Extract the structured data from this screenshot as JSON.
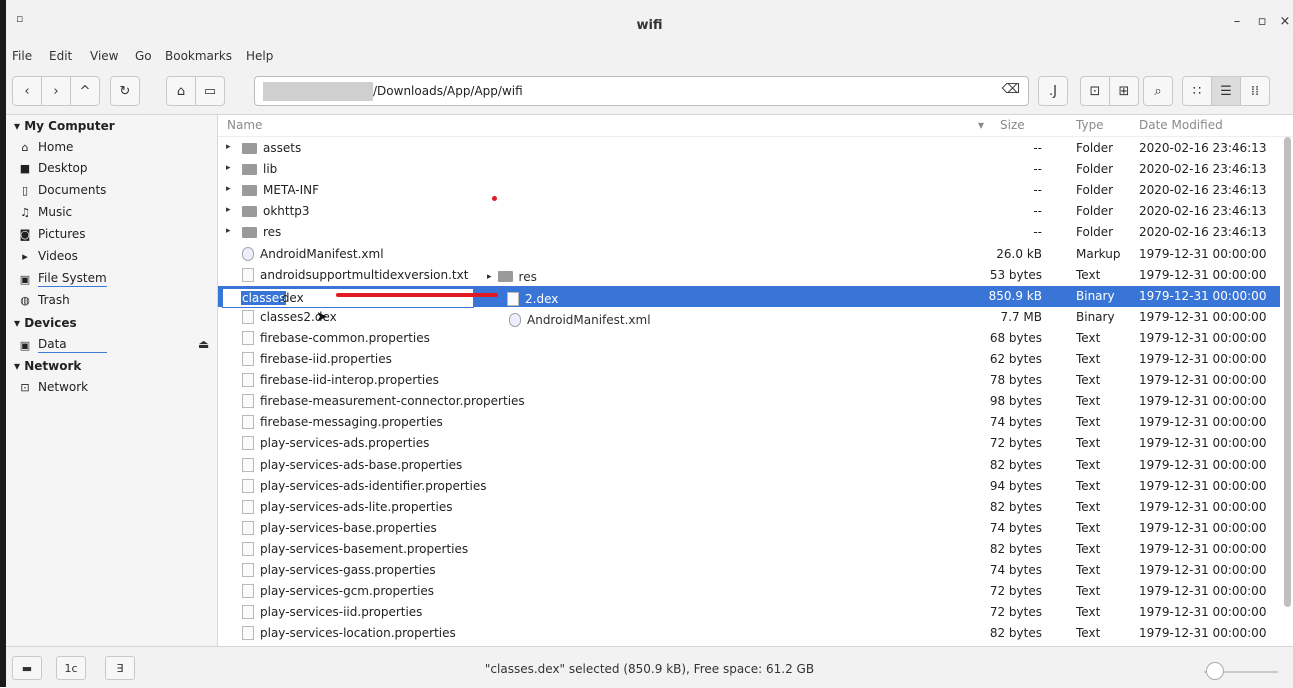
{
  "window": {
    "title": "wifi",
    "menu_icon": "▫",
    "minimize": "–",
    "maximize": "▫",
    "close": "×"
  },
  "menu": [
    "File",
    "Edit",
    "View",
    "Go",
    "Bookmarks",
    "Help"
  ],
  "toolbar": {
    "back": "‹",
    "forward": "›",
    "up": "^",
    "reload": "↻",
    "home": "⌂",
    "computer": "▭",
    "path": "/Downloads/App/App/wifi",
    "clear": "⌫",
    "terminal": "⊡",
    "new_tab": "⊞",
    "search": "⌕",
    "icon_view": "∷",
    "list_view": "☰",
    "compact_view": "⁞⁞"
  },
  "sidebar": {
    "sections": [
      {
        "title": "My Computer",
        "items": [
          {
            "label": "Home",
            "icon": "home-icon"
          },
          {
            "label": "Desktop",
            "icon": "desktop-folder-icon"
          },
          {
            "label": "Documents",
            "icon": "document-icon"
          },
          {
            "label": "Music",
            "icon": "music-icon"
          },
          {
            "label": "Pictures",
            "icon": "camera-icon"
          },
          {
            "label": "Videos",
            "icon": "video-icon"
          },
          {
            "label": "File System",
            "icon": "drive-icon"
          },
          {
            "label": "Trash",
            "icon": "trash-icon"
          }
        ]
      },
      {
        "title": "Devices",
        "items": [
          {
            "label": "Data",
            "icon": "drive-icon",
            "eject": "⏏"
          }
        ]
      },
      {
        "title": "Network",
        "items": [
          {
            "label": "Network",
            "icon": "network-icon"
          }
        ]
      }
    ]
  },
  "columns": {
    "name": "Name",
    "size": "Size",
    "type": "Type",
    "date": "Date Modified"
  },
  "files": [
    {
      "name": "assets",
      "size": "--",
      "type": "Folder",
      "date": "2020-02-16 23:46:13",
      "kind": "folder"
    },
    {
      "name": "lib",
      "size": "--",
      "type": "Folder",
      "date": "2020-02-16 23:46:13",
      "kind": "folder"
    },
    {
      "name": "META-INF",
      "size": "--",
      "type": "Folder",
      "date": "2020-02-16 23:46:13",
      "kind": "folder"
    },
    {
      "name": "okhttp3",
      "size": "--",
      "type": "Folder",
      "date": "2020-02-16 23:46:13",
      "kind": "folder"
    },
    {
      "name": "res",
      "size": "--",
      "type": "Folder",
      "date": "2020-02-16 23:46:13",
      "kind": "folder"
    },
    {
      "name": "AndroidManifest.xml",
      "size": "26.0 kB",
      "type": "Markup",
      "date": "1979-12-31 00:00:00",
      "kind": "xml"
    },
    {
      "name": "androidsupportmultidexversion.txt",
      "size": "53 bytes",
      "type": "Text",
      "date": "1979-12-31 00:00:00",
      "kind": "file"
    },
    {
      "name": "classes.dex",
      "size": "850.9 kB",
      "type": "Binary",
      "date": "1979-12-31 00:00:00",
      "kind": "file",
      "selected": true
    },
    {
      "name": "classes2.dex",
      "size": "7.7 MB",
      "type": "Binary",
      "date": "1979-12-31 00:00:00",
      "kind": "file"
    },
    {
      "name": "firebase-common.properties",
      "size": "68 bytes",
      "type": "Text",
      "date": "1979-12-31 00:00:00",
      "kind": "file"
    },
    {
      "name": "firebase-iid.properties",
      "size": "62 bytes",
      "type": "Text",
      "date": "1979-12-31 00:00:00",
      "kind": "file"
    },
    {
      "name": "firebase-iid-interop.properties",
      "size": "78 bytes",
      "type": "Text",
      "date": "1979-12-31 00:00:00",
      "kind": "file"
    },
    {
      "name": "firebase-measurement-connector.properties",
      "size": "98 bytes",
      "type": "Text",
      "date": "1979-12-31 00:00:00",
      "kind": "file"
    },
    {
      "name": "firebase-messaging.properties",
      "size": "74 bytes",
      "type": "Text",
      "date": "1979-12-31 00:00:00",
      "kind": "file"
    },
    {
      "name": "play-services-ads.properties",
      "size": "72 bytes",
      "type": "Text",
      "date": "1979-12-31 00:00:00",
      "kind": "file"
    },
    {
      "name": "play-services-ads-base.properties",
      "size": "82 bytes",
      "type": "Text",
      "date": "1979-12-31 00:00:00",
      "kind": "file"
    },
    {
      "name": "play-services-ads-identifier.properties",
      "size": "94 bytes",
      "type": "Text",
      "date": "1979-12-31 00:00:00",
      "kind": "file"
    },
    {
      "name": "play-services-ads-lite.properties",
      "size": "82 bytes",
      "type": "Text",
      "date": "1979-12-31 00:00:00",
      "kind": "file"
    },
    {
      "name": "play-services-base.properties",
      "size": "74 bytes",
      "type": "Text",
      "date": "1979-12-31 00:00:00",
      "kind": "file"
    },
    {
      "name": "play-services-basement.properties",
      "size": "82 bytes",
      "type": "Text",
      "date": "1979-12-31 00:00:00",
      "kind": "file"
    },
    {
      "name": "play-services-gass.properties",
      "size": "74 bytes",
      "type": "Text",
      "date": "1979-12-31 00:00:00",
      "kind": "file"
    },
    {
      "name": "play-services-gcm.properties",
      "size": "72 bytes",
      "type": "Text",
      "date": "1979-12-31 00:00:00",
      "kind": "file"
    },
    {
      "name": "play-services-iid.properties",
      "size": "72 bytes",
      "type": "Text",
      "date": "1979-12-31 00:00:00",
      "kind": "file"
    },
    {
      "name": "play-services-location.properties",
      "size": "82 bytes",
      "type": "Text",
      "date": "1979-12-31 00:00:00",
      "kind": "file"
    }
  ],
  "rename": {
    "selected_part": "classes",
    "rest": ".dex"
  },
  "overlay": [
    {
      "name": "res",
      "kind": "folder"
    },
    {
      "name": "2.dex",
      "kind": "file",
      "selected": true
    },
    {
      "name": "AndroidManifest.xml",
      "kind": "xml"
    }
  ],
  "status": {
    "text": "\"classes.dex\" selected (850.9 kB), Free space: 61.2 GB",
    "btn1": "▬",
    "btn2": "1c",
    "btn3": "∃"
  }
}
